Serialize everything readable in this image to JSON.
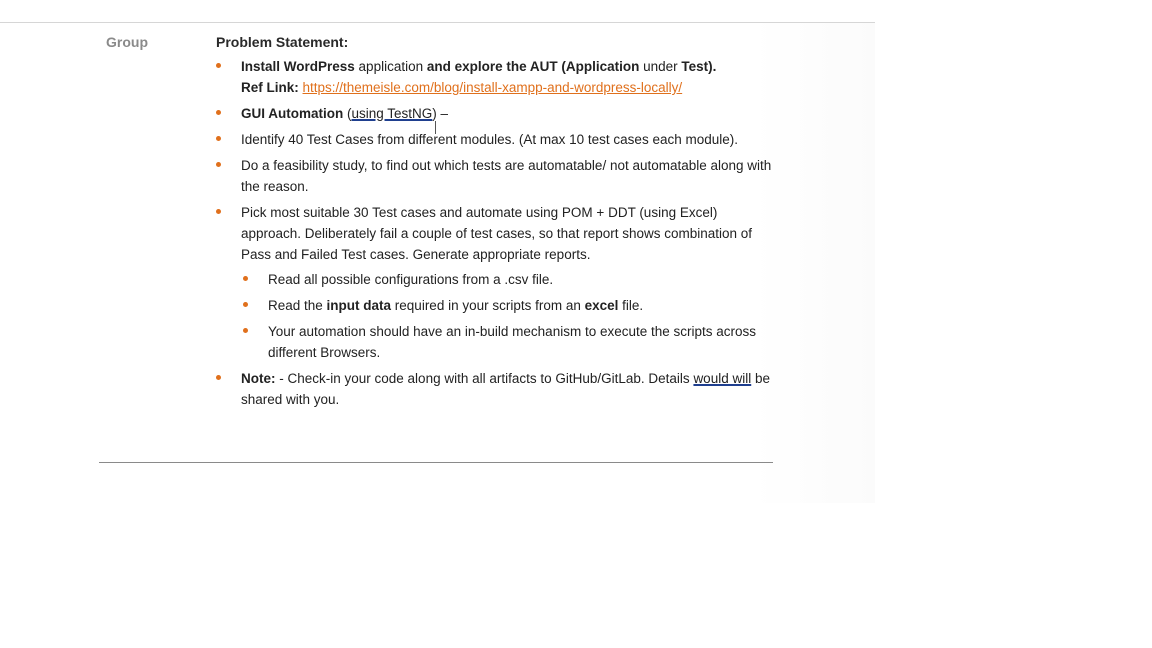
{
  "group_label": "Group",
  "problem_heading": "Problem Statement:",
  "items": {
    "i0": {
      "a": "Install WordPress",
      "b": " application ",
      "c": "and explore the AUT (Application",
      "d": " under ",
      "e": "Test).",
      "ref_label": "Ref Link: ",
      "ref_url": "https://themeisle.com/blog/install-xampp-and-wordpress-locally/"
    },
    "i1": {
      "a": "GUI Automation",
      "b": " (",
      "c": "using TestNG",
      "d": ") –"
    },
    "i2": {
      "text": "Identify 40 Test Cases from different modules. (At max 10 test cases each module)."
    },
    "i3": {
      "text": "Do a feasibility study, to find out which tests are automatable/ not automatable along with the reason."
    },
    "i4": {
      "a": "Pick most suitable 30 Test cases and automate using POM + DDT (using Excel) approach. Deliberately fail a couple of test cases, so that report shows combination of Pass and Failed Test cases. Generate appropriate reports."
    },
    "sub": {
      "s0": "Read all possible configurations from a .csv file.",
      "s1a": "Read the ",
      "s1b": "input data",
      "s1c": " required in your scripts from an ",
      "s1d": "excel",
      "s1e": " file.",
      "s2": "Your automation should have an in-build mechanism to execute the scripts across different Browsers."
    },
    "i5": {
      "a": "Note:",
      "b": " - Check-in your code along with all artifacts to GitHub/GitLab. Details ",
      "c": "would will",
      "d": " be shared with you."
    }
  },
  "colors": {
    "bullet": "#e0701c",
    "link": "#e0701c",
    "group_label": "#8a8a8a"
  }
}
